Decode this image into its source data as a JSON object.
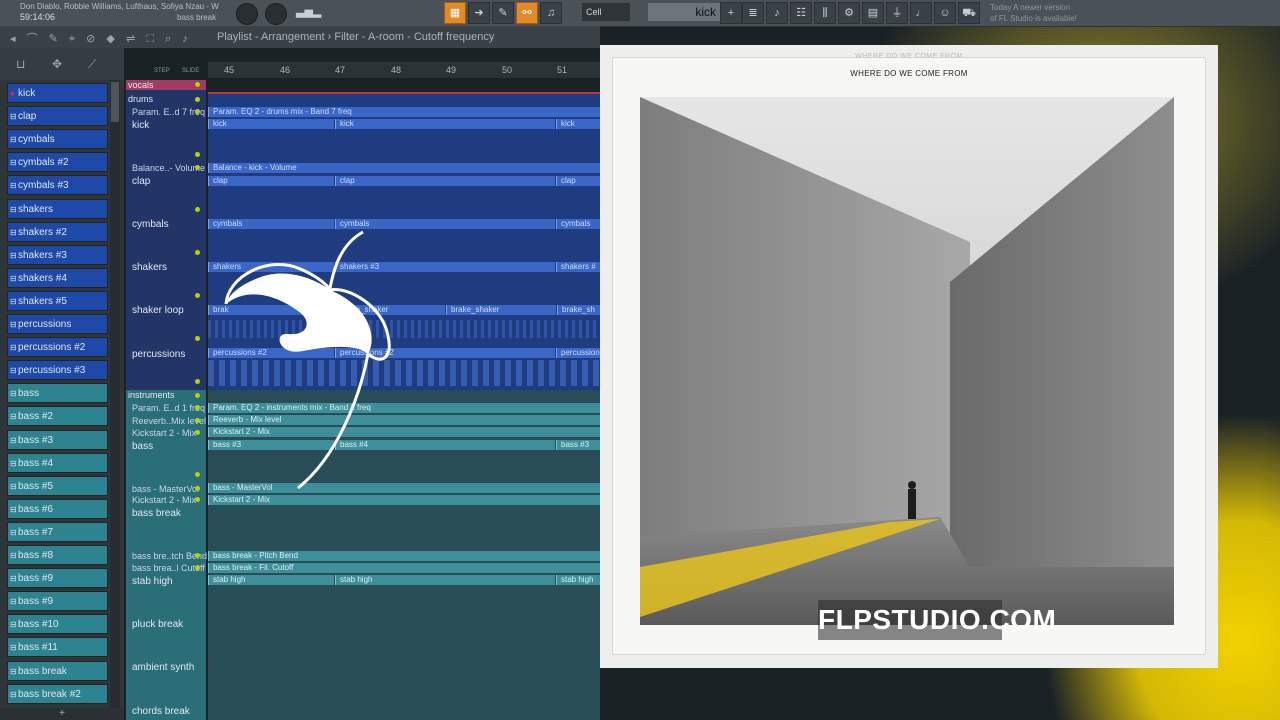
{
  "toolbar": {
    "song_artists": "Don Diablo, Robbie Williams, Lufthaus, Sofiya Nzau - W",
    "song_time": "59:14:06",
    "song_label": "bass break",
    "pattern_mode": "Cell",
    "current_channel": "kick",
    "news_line1": "Today  A newer version",
    "news_line2": "of FL Studio is available!"
  },
  "playlist_bar": {
    "breadcrumb": "Playlist - Arrangement  ›  Filter - A-room - Cutoff frequency",
    "snap_label": "STEP",
    "slide_label": "SLIDE"
  },
  "ruler": [
    "45",
    "46",
    "47",
    "48",
    "49",
    "50",
    "51"
  ],
  "channels": [
    {
      "label": "kick",
      "color": "blue"
    },
    {
      "label": "clap",
      "color": "blue"
    },
    {
      "label": "cymbals",
      "color": "blue"
    },
    {
      "label": "cymbals #2",
      "color": "blue"
    },
    {
      "label": "cymbals #3",
      "color": "blue"
    },
    {
      "label": "shakers",
      "color": "blue"
    },
    {
      "label": "shakers #2",
      "color": "blue"
    },
    {
      "label": "shakers #3",
      "color": "blue"
    },
    {
      "label": "shakers #4",
      "color": "blue"
    },
    {
      "label": "shakers #5",
      "color": "blue"
    },
    {
      "label": "percussions",
      "color": "blue"
    },
    {
      "label": "percussions #2",
      "color": "blue"
    },
    {
      "label": "percussions #3",
      "color": "blue"
    },
    {
      "label": "bass",
      "color": "teal"
    },
    {
      "label": "bass #2",
      "color": "teal"
    },
    {
      "label": "bass #3",
      "color": "teal"
    },
    {
      "label": "bass #4",
      "color": "teal"
    },
    {
      "label": "bass #5",
      "color": "teal"
    },
    {
      "label": "bass #6",
      "color": "teal"
    },
    {
      "label": "bass #7",
      "color": "teal"
    },
    {
      "label": "bass #8",
      "color": "teal"
    },
    {
      "label": "bass #9",
      "color": "teal"
    },
    {
      "label": "bass #9",
      "color": "teal"
    },
    {
      "label": "bass #10",
      "color": "teal"
    },
    {
      "label": "bass #11",
      "color": "teal"
    },
    {
      "label": "bass break",
      "color": "teal"
    },
    {
      "label": "bass break #2",
      "color": "teal"
    }
  ],
  "tracks": {
    "group_vocals": "vocals",
    "group_drums": "drums",
    "group_instruments": "instruments",
    "labels": [
      "Param. E..d 7 freq",
      "kick",
      "Balance..- Volume",
      "clap",
      "cymbals",
      "shakers",
      "shaker loop",
      "percussions",
      "Param. E..d 1 freq",
      "Reeverb..Mix level",
      "Kickstart 2 - Mix",
      "bass",
      "bass - MasterVol",
      "Kickstart 2 - Mix",
      "bass break",
      "bass bre..tch Bend",
      "bass brea..l Cutoff",
      "stab high",
      "pluck break",
      "ambient synth",
      "chords break"
    ]
  },
  "clips": {
    "drums_auto": "Param. EQ 2 - drums mix - Band 7 freq",
    "kick": "kick",
    "balance": "Balance - kick - Volume",
    "clap": "clap",
    "cymbals": "cymbals",
    "shakers": "shakers",
    "shakers3": "shakers #3",
    "shakers_tail": "shakers #",
    "brake_shaker": "brake_shaker",
    "brake_sh": "brake_sh",
    "brake_prefix": "brak",
    "percussions2": "percussions #2",
    "percussion": "percussion",
    "instr_auto": "Param. EQ 2 - instruments mix - Band 1 freq",
    "reeverb": "Reeverb - Mix level",
    "kickstart": "Kickstart 2 - Mix",
    "bass3": "bass #3",
    "bass4": "bass #4",
    "bass_mv": "bass - MasterVol",
    "kickstart2": "Kickstart 2 - Mix",
    "pitch": "bass break - Pitch Bend",
    "cutoff": "bass break - Fil. Cutoff",
    "stab": "stab high"
  },
  "album": {
    "title_ghost": "WHERE DO WE COME FROM",
    "title": "WHERE DO WE COME FROM"
  },
  "watermark": "FLPSTUDIO.COM",
  "colors": {
    "accent": "#e08a2a",
    "drums": "#1f49a8",
    "instruments": "#2e8390",
    "smoke": "#f3d200"
  }
}
